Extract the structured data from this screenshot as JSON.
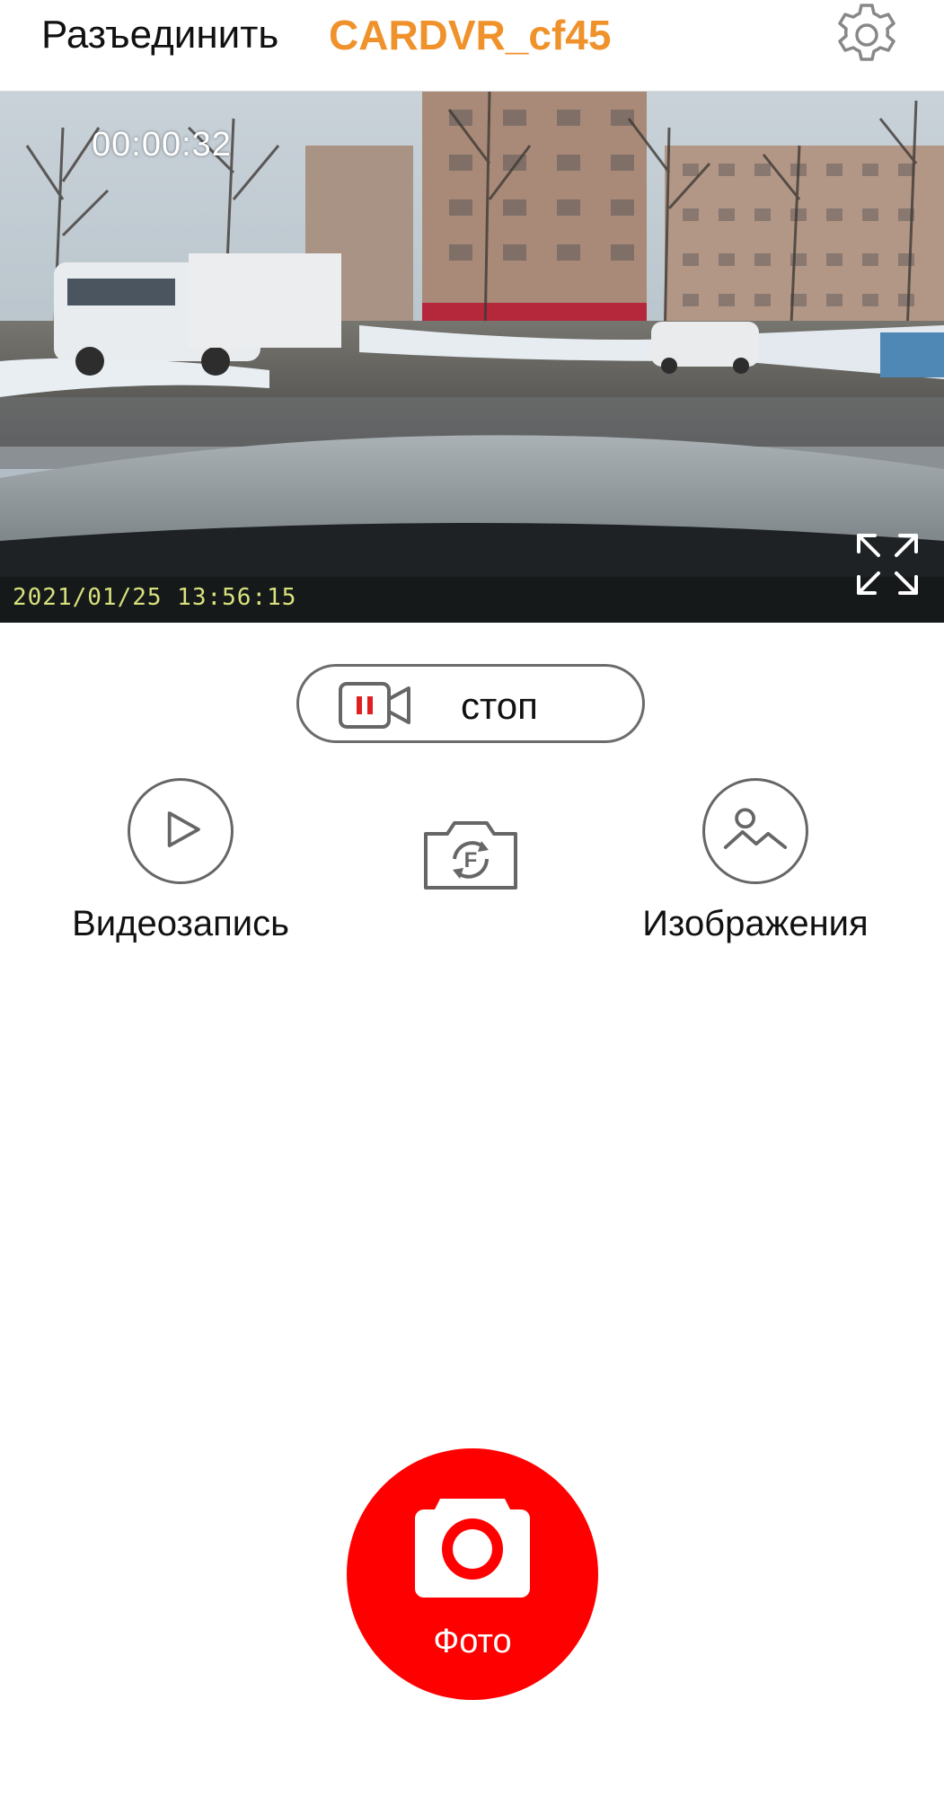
{
  "header": {
    "disconnect_label": "Разъединить",
    "device_name": "CARDVR_cf45",
    "accent_color": "#f0922b"
  },
  "video": {
    "recording_timer": "00:00:32",
    "timestamp": "2021/01/25  13:56:15"
  },
  "controls": {
    "stop_label": "стоп",
    "videos_label": "Видеозапись",
    "images_label": "Изображения",
    "photo_label": "Фото",
    "photo_color": "#ff0000"
  },
  "icons": [
    "settings-gear-icon",
    "fullscreen-expand-icon",
    "pause-video-icon",
    "play-icon",
    "camera-switch-icon",
    "gallery-image-icon",
    "camera-icon"
  ]
}
